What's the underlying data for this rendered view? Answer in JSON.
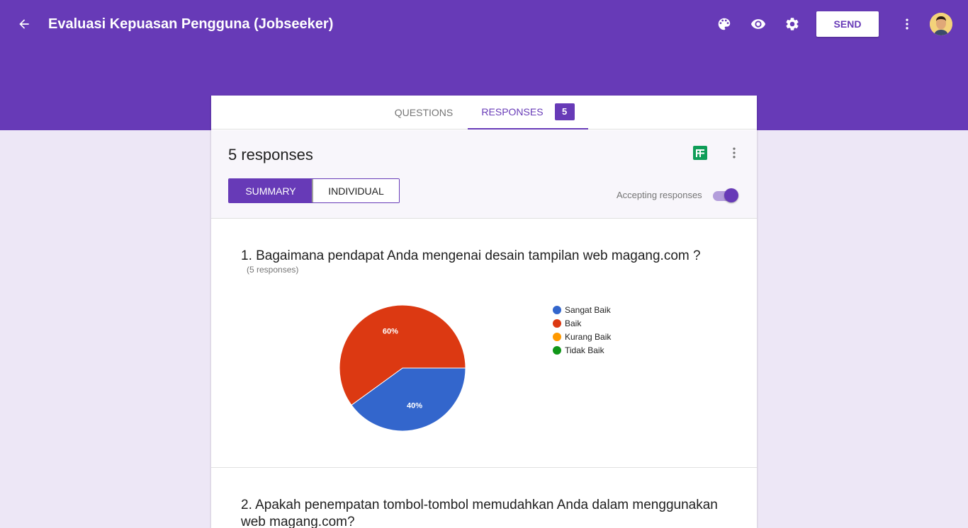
{
  "header": {
    "title": "Evaluasi Kepuasan Pengguna (Jobseeker)",
    "send_label": "SEND",
    "bg_color": "#673ab7"
  },
  "tabs": {
    "questions_label": "QUESTIONS",
    "responses_label": "RESPONSES",
    "responses_badge": "5"
  },
  "responses": {
    "count_label": "5 responses",
    "summary_label": "SUMMARY",
    "individual_label": "INDIVIDUAL",
    "accepting_label": "Accepting responses",
    "accepting_on": true
  },
  "questions": [
    {
      "title": "1. Bagaimana pendapat Anda mengenai desain tampilan web magang.com ?",
      "subtitle": "(5 responses)"
    },
    {
      "title": "2. Apakah penempatan tombol-tombol memudahkan Anda dalam menggunakan web magang.com?"
    }
  ],
  "chart_data": {
    "type": "pie",
    "categories": [
      "Sangat Baik",
      "Baik",
      "Kurang Baik",
      "Tidak Baik"
    ],
    "values": [
      40,
      60,
      0,
      0
    ],
    "labels": [
      "40%",
      "60%",
      "",
      ""
    ],
    "colors": [
      "#3366cc",
      "#dc3912",
      "#ff9900",
      "#109618"
    ],
    "legend_position": "right"
  }
}
